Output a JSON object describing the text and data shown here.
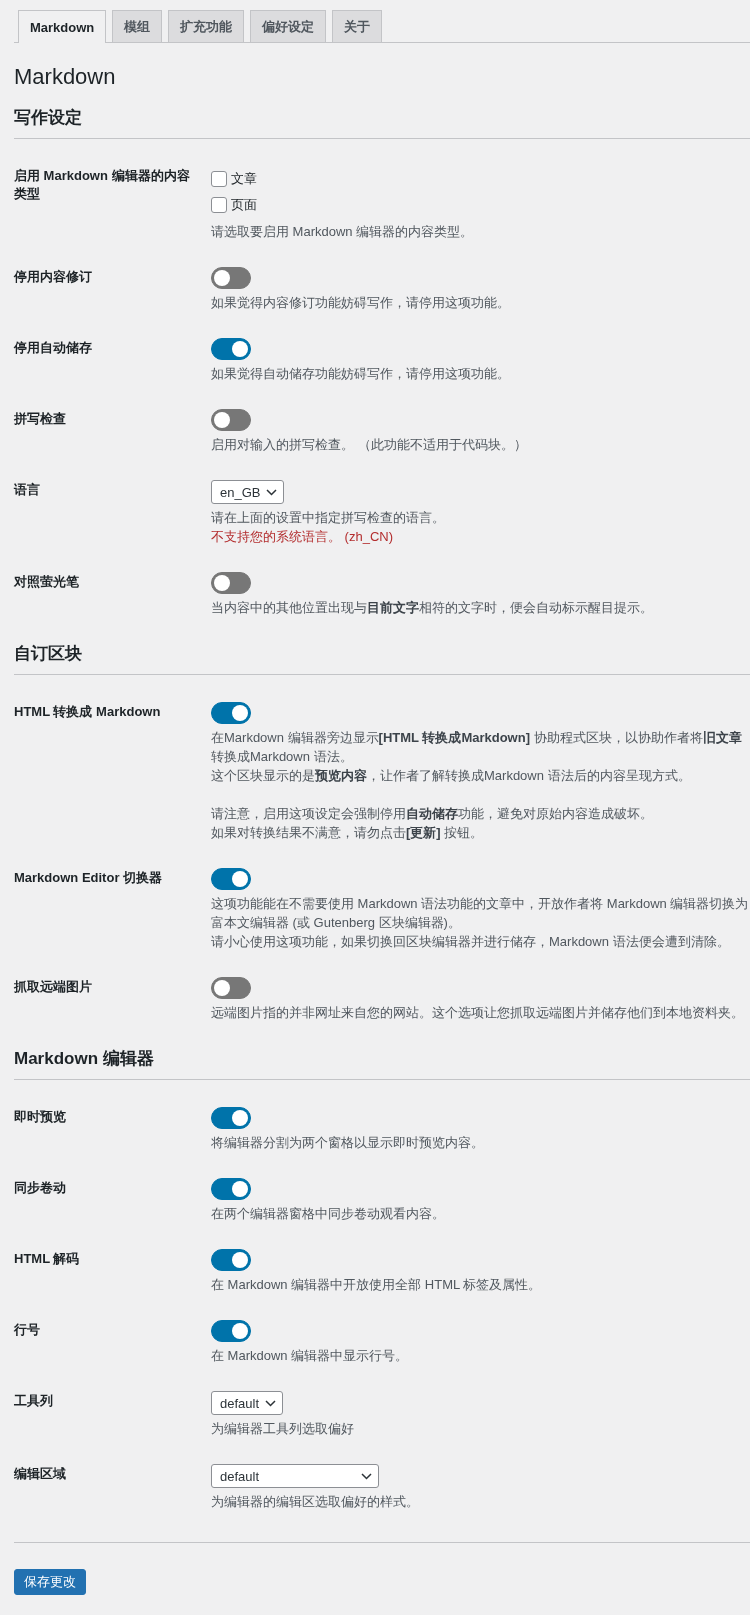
{
  "tabs": [
    {
      "label": "Markdown",
      "selected": true
    },
    {
      "label": "模组",
      "selected": false
    },
    {
      "label": "扩充功能",
      "selected": false
    },
    {
      "label": "偏好设定",
      "selected": false
    },
    {
      "label": "关于",
      "selected": false
    }
  ],
  "title": "Markdown",
  "sections": [
    {
      "heading": "写作设定",
      "rows": [
        {
          "kind": "checkboxes",
          "label": "启用 Markdown 编辑器的内容类型",
          "options": [
            {
              "label": "文章",
              "checked": false
            },
            {
              "label": "页面",
              "checked": false
            }
          ],
          "description": [
            [
              "请选取要启用 Markdown 编辑器的内容类型。"
            ]
          ]
        },
        {
          "kind": "toggle",
          "label": "停用内容修订",
          "on": false,
          "description": [
            [
              "如果觉得内容修订功能妨碍写作，请停用这项功能。"
            ]
          ]
        },
        {
          "kind": "toggle",
          "label": "停用自动储存",
          "on": true,
          "description": [
            [
              "如果觉得自动储存功能妨碍写作，请停用这项功能。"
            ]
          ]
        },
        {
          "kind": "toggle",
          "label": "拼写检查",
          "on": false,
          "description": [
            [
              "启用对输入的拼写检查。 （此功能不适用于代码块。）"
            ]
          ]
        },
        {
          "kind": "select",
          "label": "语言",
          "value": "en_GB",
          "description": [
            [
              "请在上面的设置中指定拼写检查的语言。"
            ]
          ],
          "error": "不支持您的系统语言。 (zh_CN)"
        },
        {
          "kind": "toggle",
          "label": "对照萤光笔",
          "on": false,
          "description": [
            [
              "当内容中的其他位置出现与**目前文字**相符的文字时，便会自动标示醒目提示。"
            ]
          ]
        }
      ]
    },
    {
      "heading": "自订区块",
      "rows": [
        {
          "kind": "toggle",
          "label": "HTML 转换成 Markdown",
          "on": true,
          "description": [
            [
              "在Markdown 编辑器旁边显示**[HTML 转换成Markdown]** 协助程式区块，以协助作者将**旧文章**转换成Markdown 语法。",
              "这个区块显示的是**预览内容**，让作者了解转换成Markdown 语法后的内容呈现方式。"
            ],
            [
              "请注意，启用这项设定会强制停用**自动储存**功能，避免对原始内容造成破坏。",
              "如果对转换结果不满意，请勿点击**[更新]** 按钮。"
            ]
          ]
        },
        {
          "kind": "toggle",
          "label": "Markdown Editor 切换器",
          "on": true,
          "description": [
            [
              "这项功能能在不需要使用 Markdown 语法功能的文章中，开放作者将 Markdown 编辑器切换为富本文编辑器 (或 Gutenberg 区块编辑器)。",
              "请小心使用这项功能，如果切换回区块编辑器并进行储存，Markdown 语法便会遭到清除。"
            ]
          ]
        },
        {
          "kind": "toggle",
          "label": "抓取远端图片",
          "on": false,
          "description": [
            [
              "远端图片指的并非网址来自您的网站。这个选项让您抓取远端图片并储存他们到本地资料夹。"
            ]
          ]
        }
      ]
    },
    {
      "heading": "Markdown 编辑器",
      "rows": [
        {
          "kind": "toggle",
          "label": "即时预览",
          "on": true,
          "description": [
            [
              "将编辑器分割为两个窗格以显示即时预览内容。"
            ]
          ]
        },
        {
          "kind": "toggle",
          "label": "同步卷动",
          "on": true,
          "description": [
            [
              "在两个编辑器窗格中同步卷动观看内容。"
            ]
          ]
        },
        {
          "kind": "toggle",
          "label": "HTML 解码",
          "on": true,
          "description": [
            [
              "在 Markdown 编辑器中开放使用全部 HTML 标签及属性。"
            ]
          ]
        },
        {
          "kind": "toggle",
          "label": "行号",
          "on": true,
          "description": [
            [
              "在 Markdown 编辑器中显示行号。"
            ]
          ]
        },
        {
          "kind": "select",
          "label": "工具列",
          "value": "default",
          "description": [
            [
              "为编辑器工具列选取偏好"
            ]
          ]
        },
        {
          "kind": "wide-select",
          "label": "编辑区域",
          "value": "default",
          "description": [
            [
              "为编辑器的编辑区选取偏好的样式。"
            ]
          ]
        }
      ]
    }
  ],
  "save_button": "保存更改"
}
